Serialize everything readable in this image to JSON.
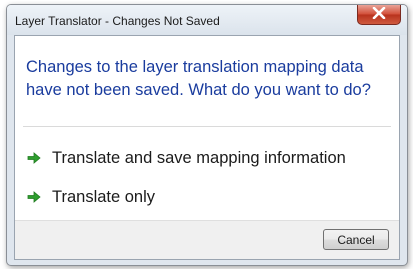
{
  "window": {
    "title": "Layer Translator - Changes Not Saved"
  },
  "dialog": {
    "instruction": "Changes to the layer translation mapping data have not been saved. What do you want to do?",
    "commands": [
      {
        "label": "Translate and save mapping information",
        "icon": "green-arrow-icon"
      },
      {
        "label": "Translate only",
        "icon": "green-arrow-icon"
      }
    ],
    "cancel_label": "Cancel"
  },
  "colors": {
    "instruction_text": "#1a3c9e",
    "arrow_green": "#2e9e2e",
    "close_button_red": "#c7432b"
  }
}
